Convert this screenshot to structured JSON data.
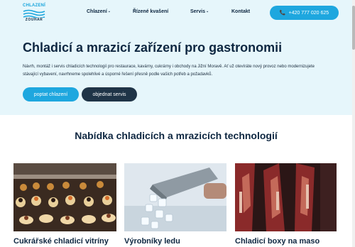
{
  "logo": {
    "line1": "CHLAZENÍ",
    "line2": "ZOUHAR"
  },
  "nav": {
    "items": [
      {
        "label": "Chlazení",
        "has_dropdown": true
      },
      {
        "label": "Řízené kvašení",
        "has_dropdown": false
      },
      {
        "label": "Servis",
        "has_dropdown": true
      },
      {
        "label": "Kontakt",
        "has_dropdown": false
      }
    ],
    "phone": "+420 777 020 625",
    "phone_icon": "phone-icon"
  },
  "hero": {
    "title": "Chladicí a mrazicí zařízení pro gastronomii",
    "description": "Návrh, montáž i servis chladicích technologií pro restaurace, kavárny, cukrárny i obchody na Jižní Moravě. Ať už otevíráte nový provoz nebo modernizujete stávající vybavení, navrhneme spolehlivé a úsporné řešení přesně podle vašich potřeb a požadavků.",
    "primary_button": "poptat chlazení",
    "secondary_button": "objednat servis"
  },
  "section": {
    "title": "Nabídka chladicích a mrazicích technologií"
  },
  "cards": [
    {
      "title": "Cukrářské chladicí vitríny"
    },
    {
      "title": "Výrobníky ledu"
    },
    {
      "title": "Chladicí boxy na maso"
    }
  ],
  "colors": {
    "accent": "#1ea7df",
    "dark": "#0e2741",
    "hero_bg": "#e6f6fb",
    "button_dark": "#1f3447"
  }
}
